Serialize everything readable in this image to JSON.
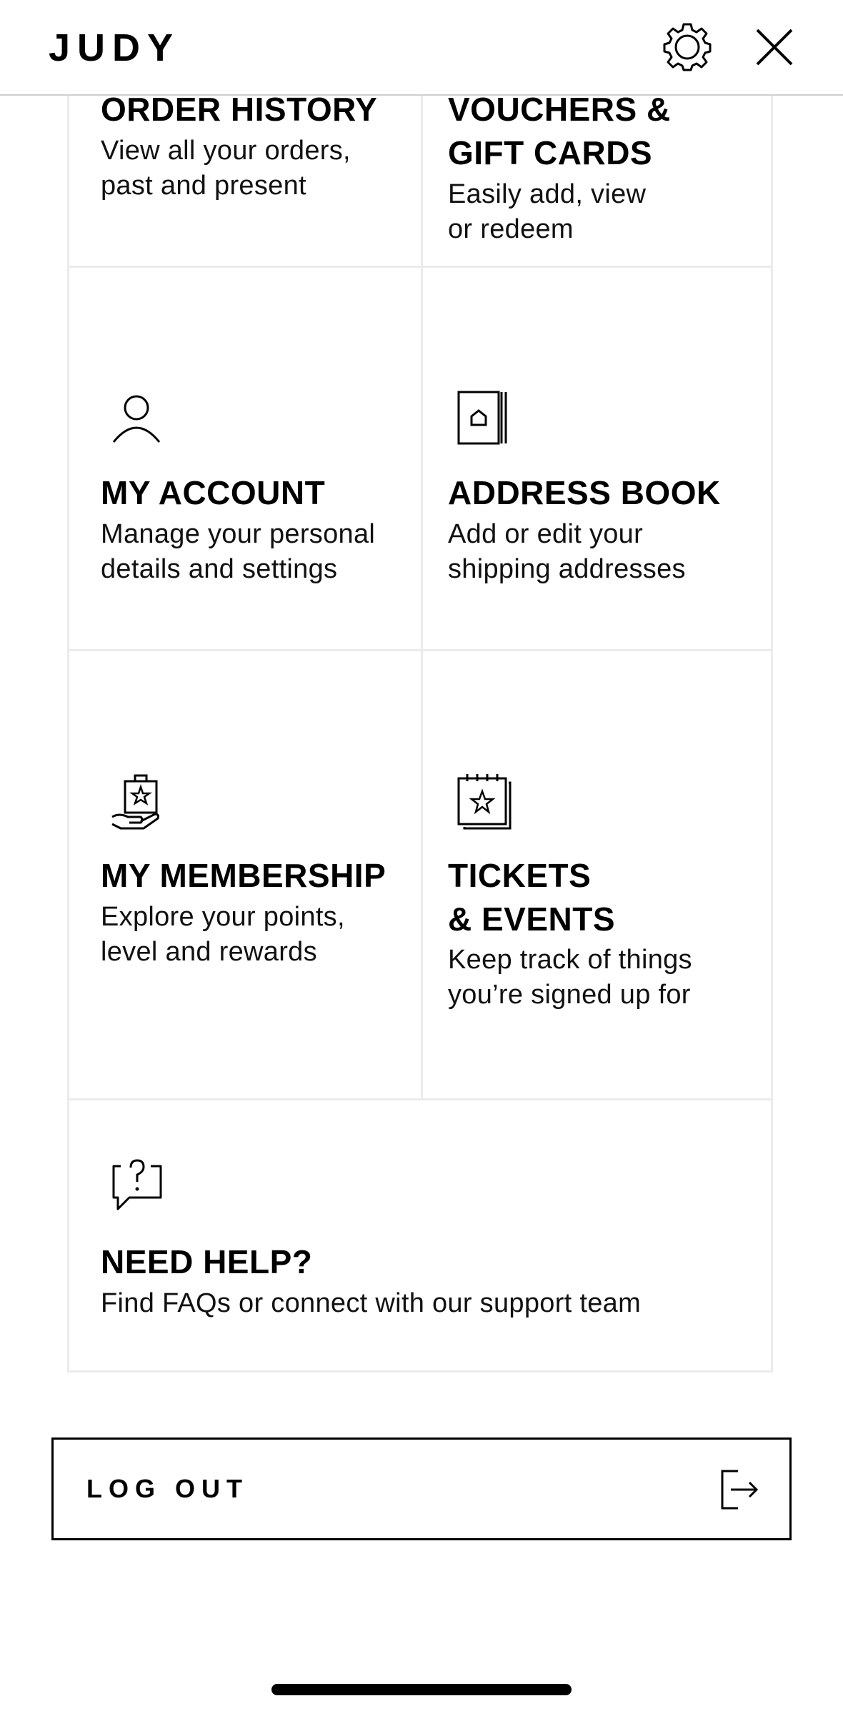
{
  "header": {
    "brand": "JUDY",
    "settings_icon": "gear-icon",
    "close_icon": "close-icon"
  },
  "cards": {
    "order_history": {
      "title": "ORDER HISTORY",
      "desc": "View all your orders,\npast and present"
    },
    "vouchers": {
      "title": "VOUCHERS &\nGIFT CARDS",
      "desc": "Easily add, view\nor redeem"
    },
    "account": {
      "icon": "user-icon",
      "title": "MY ACCOUNT",
      "desc": "Manage your personal\ndetails and settings"
    },
    "address": {
      "icon": "address-book-icon",
      "title": "ADDRESS BOOK",
      "desc": "Add or edit your\nshipping addresses"
    },
    "membership": {
      "icon": "membership-bag-icon",
      "title": "MY MEMBERSHIP",
      "desc": "Explore your points,\nlevel and rewards"
    },
    "tickets": {
      "icon": "ticket-calendar-icon",
      "title": "TICKETS\n& EVENTS",
      "desc": "Keep track of things\nyou’re signed up for"
    },
    "help": {
      "icon": "help-chat-icon",
      "title": "NEED HELP?",
      "desc": "Find FAQs or connect with our support team"
    }
  },
  "logout": {
    "label": "LOG OUT",
    "icon": "logout-icon"
  },
  "colors": {
    "text": "#000000",
    "divider": "#ebebeb",
    "header_border": "#cfcfcf"
  }
}
